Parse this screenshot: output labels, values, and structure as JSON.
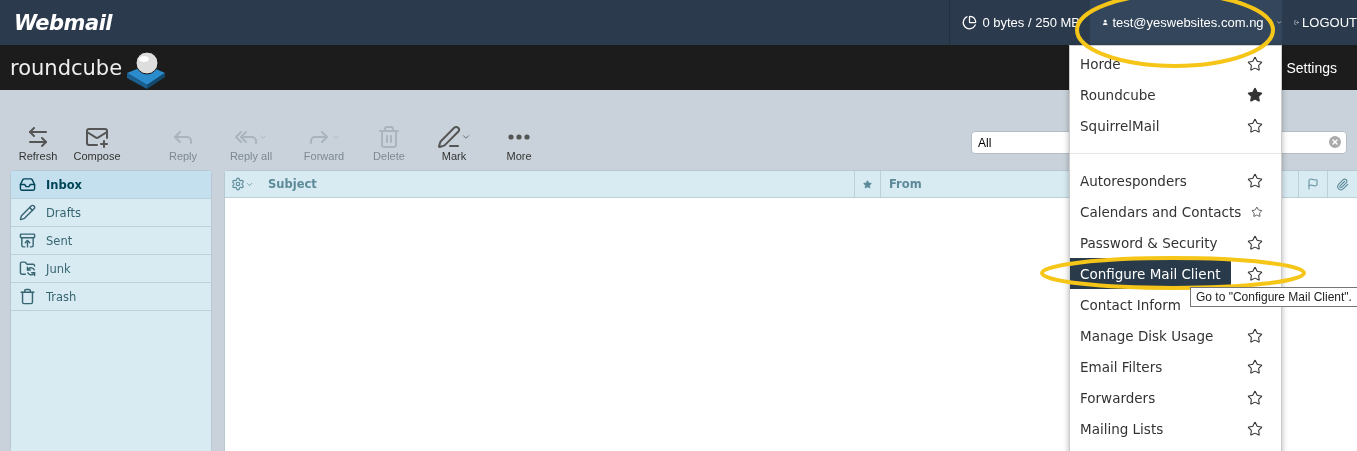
{
  "header": {
    "logo": "Webmail",
    "quota": "0 bytes / 250 MB",
    "user": "test@yeswebsites.com.ng",
    "logout": "LOGOUT"
  },
  "app_bar": {
    "logo": "roundcube",
    "settings": "Settings"
  },
  "toolbar": [
    {
      "label": "Refresh",
      "disabled": false,
      "has_menu": false
    },
    {
      "label": "Compose",
      "disabled": false,
      "has_menu": false
    },
    {
      "label": "Reply",
      "disabled": true,
      "has_menu": false
    },
    {
      "label": "Reply all",
      "disabled": true,
      "has_menu": true
    },
    {
      "label": "Forward",
      "disabled": true,
      "has_menu": true
    },
    {
      "label": "Delete",
      "disabled": true,
      "has_menu": false
    },
    {
      "label": "Mark",
      "disabled": false,
      "has_menu": true
    },
    {
      "label": "More",
      "disabled": false,
      "has_menu": false
    }
  ],
  "search": {
    "value": "All"
  },
  "folders": [
    {
      "name": "Inbox",
      "selected": true
    },
    {
      "name": "Drafts",
      "selected": false
    },
    {
      "name": "Sent",
      "selected": false
    },
    {
      "name": "Junk",
      "selected": false
    },
    {
      "name": "Trash",
      "selected": false
    }
  ],
  "message_list": {
    "columns": [
      "Subject",
      "From"
    ]
  },
  "user_menu": {
    "groups": [
      [
        {
          "label": "Horde",
          "starred": false,
          "selected": false
        },
        {
          "label": "Roundcube",
          "starred": true,
          "selected": false
        },
        {
          "label": "SquirrelMail",
          "starred": false,
          "selected": false
        }
      ],
      [
        {
          "label": "Autoresponders",
          "starred": false,
          "selected": false
        },
        {
          "label": "Calendars and Contacts",
          "starred": false,
          "selected": false
        },
        {
          "label": "Password & Security",
          "starred": false,
          "selected": false
        },
        {
          "label": "Configure Mail Client",
          "starred": false,
          "selected": true
        },
        {
          "label": "Contact Inform",
          "selected": false
        },
        {
          "label": "Manage Disk Usage",
          "starred": false,
          "selected": false
        },
        {
          "label": "Email Filters",
          "starred": false,
          "selected": false
        },
        {
          "label": "Forwarders",
          "starred": false,
          "selected": false
        },
        {
          "label": "Mailing Lists",
          "starred": false,
          "selected": false
        }
      ]
    ],
    "tooltip": "Go to \"Configure Mail Client\"."
  }
}
